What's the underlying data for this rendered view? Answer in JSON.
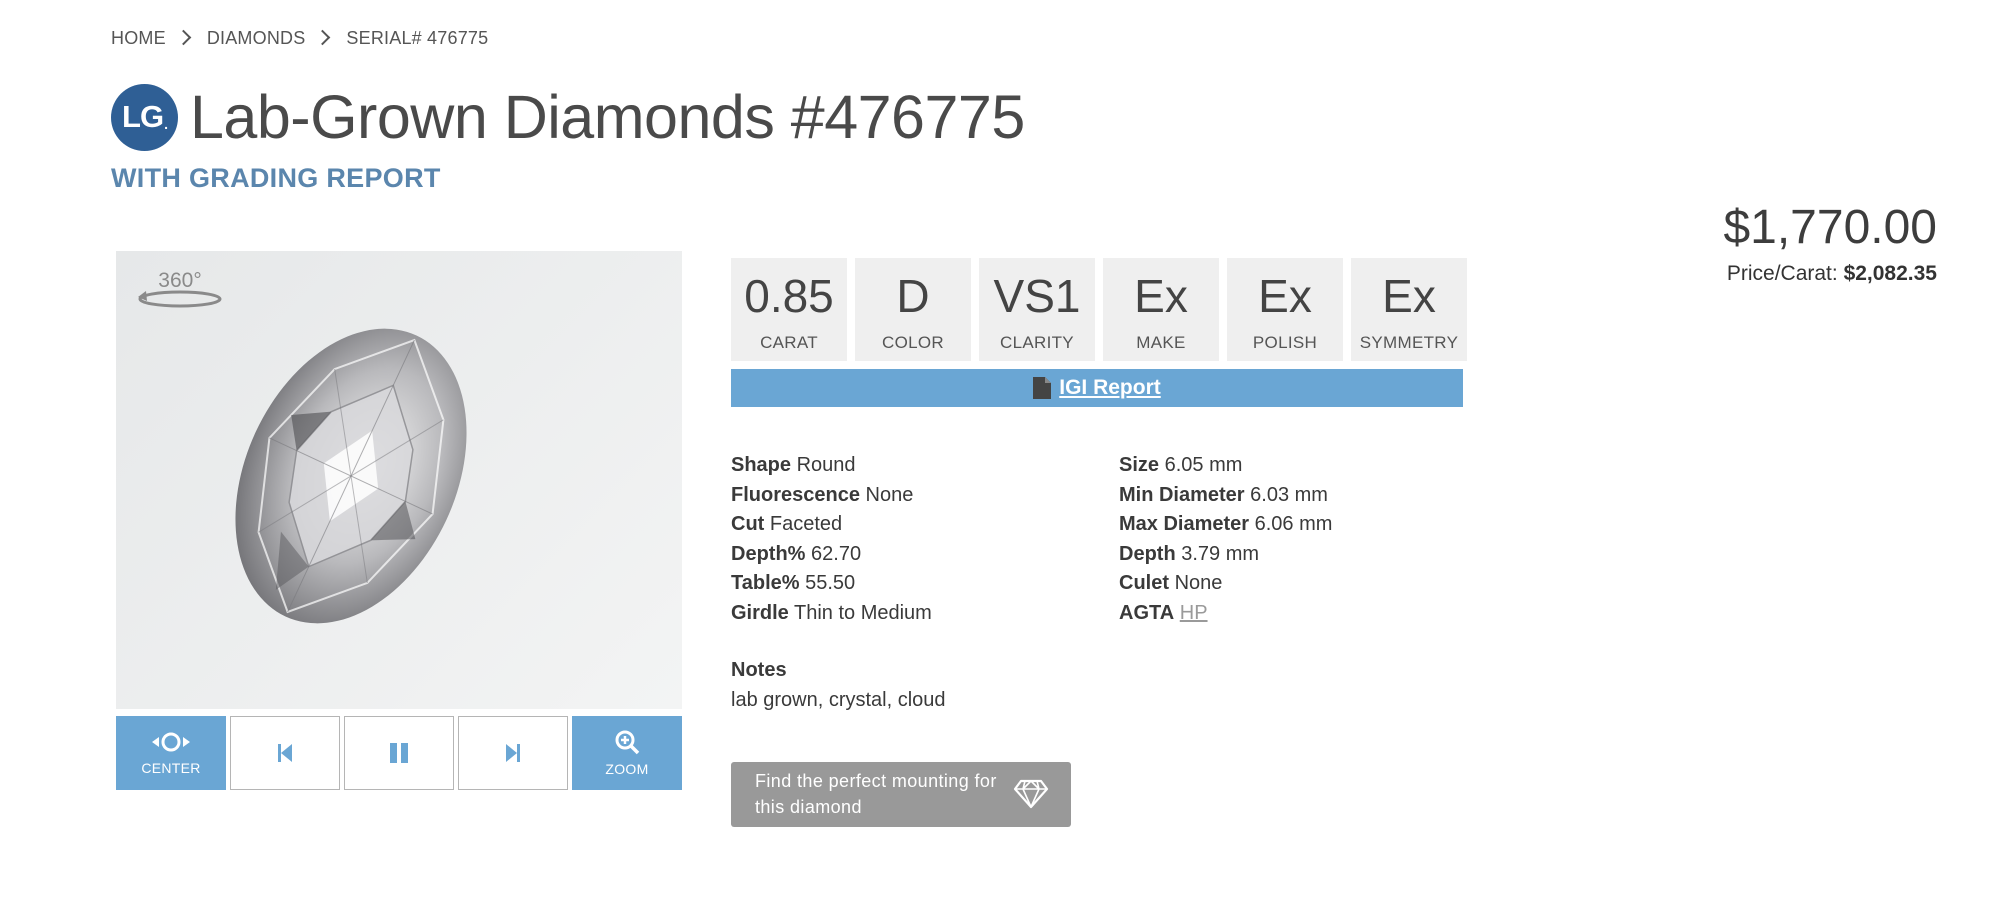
{
  "breadcrumb": [
    "HOME",
    "DIAMONDS",
    "SERIAL# 476775"
  ],
  "header": {
    "badge": "LG",
    "badge_dot": ".",
    "title": "Lab-Grown Diamonds #476775",
    "subtitle": "WITH GRADING REPORT"
  },
  "pricing": {
    "price": "$1,770.00",
    "per_carat_label": "Price/Carat:",
    "per_carat_value": "$2,082.35"
  },
  "viewer": {
    "rotation_label": "360°",
    "controls": [
      {
        "label": "CENTER",
        "icon": "center-icon"
      },
      {
        "label": "",
        "icon": "previous-icon"
      },
      {
        "label": "",
        "icon": "pause-icon"
      },
      {
        "label": "",
        "icon": "next-icon"
      },
      {
        "label": "ZOOM",
        "icon": "zoom-icon"
      }
    ]
  },
  "specs": [
    {
      "value": "0.85",
      "label": "CARAT"
    },
    {
      "value": "D",
      "label": "COLOR"
    },
    {
      "value": "VS1",
      "label": "CLARITY"
    },
    {
      "value": "Ex",
      "label": "MAKE"
    },
    {
      "value": "Ex",
      "label": "POLISH"
    },
    {
      "value": "Ex",
      "label": "SYMMETRY"
    }
  ],
  "report": {
    "label": "IGI Report",
    "icon": "document-icon"
  },
  "details_left": [
    {
      "label": "Shape",
      "value": "Round"
    },
    {
      "label": "Fluorescence",
      "value": "None"
    },
    {
      "label": "Cut",
      "value": "Faceted"
    },
    {
      "label": "Depth%",
      "value": "62.70"
    },
    {
      "label": "Table%",
      "value": "55.50"
    },
    {
      "label": "Girdle",
      "value": "Thin to Medium"
    }
  ],
  "details_right": [
    {
      "label": "Size",
      "value": "6.05 mm"
    },
    {
      "label": "Min Diameter",
      "value": "6.03 mm"
    },
    {
      "label": "Max Diameter",
      "value": "6.06 mm"
    },
    {
      "label": "Depth",
      "value": "3.79 mm"
    },
    {
      "label": "Culet",
      "value": "None"
    },
    {
      "label": "AGTA",
      "value": "HP"
    }
  ],
  "notes": {
    "label": "Notes",
    "value": "lab grown, crystal, cloud"
  },
  "mount_button": {
    "label": "Find the perfect mounting for this diamond",
    "icon": "diamond-icon"
  },
  "colors": {
    "accent": "#6aa6d4",
    "brand": "#2f5f95",
    "subtitle": "#5b86ad",
    "button_gray": "#999999",
    "tile_bg": "#efefef"
  }
}
